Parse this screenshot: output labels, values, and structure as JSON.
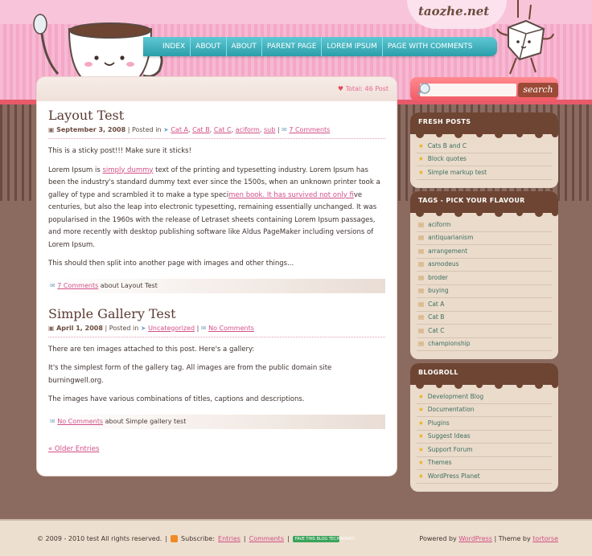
{
  "site": {
    "title": "taozhe.net"
  },
  "nav": {
    "items": [
      "INDEX",
      "ABOUT",
      "ABOUT",
      "PARENT PAGE",
      "LOREM IPSUM",
      "PAGE WITH COMMENTS"
    ]
  },
  "search": {
    "placeholder": "",
    "button_label": "search"
  },
  "main": {
    "total_posts": "Total: 46 Post"
  },
  "posts": [
    {
      "title": "Layout Test",
      "date": "September 3, 2008",
      "posted_in_label": "Posted in",
      "categories": [
        "Cat A",
        "Cat B",
        "Cat C",
        "aciform",
        "sub"
      ],
      "comments_label": "7 Comments",
      "body": {
        "p1": "This is a sticky post!!! Make sure it sticks!",
        "p2_a": "Lorem Ipsum is ",
        "p2_link1": "simply dummy",
        "p2_b": " text of the printing and typesetting industry. Lorem Ipsum has been the industry's standard dummy text ever since the 1500s, when an unknown printer took a galley of type and scrambled it to make a type speci",
        "p2_link2": "men book. It has survived not only fi",
        "p2_c": "ve centuries, but also the leap into electronic typesetting, remaining essentially unchanged. It was popularised in the 1960s with the release of Letraset sheets containing Lorem Ipsum passages, and more recently with desktop publishing software like Aldus PageMaker including versions of Lorem Ipsum.",
        "p3": "This should then split into another page with images and other things..."
      },
      "foot_comments": "7 Comments",
      "foot_about": "about Layout Test"
    },
    {
      "title": "Simple Gallery Test",
      "date": "April 1, 2008",
      "posted_in_label": "Posted in",
      "categories": [
        "Uncategorized"
      ],
      "comments_label": "No Comments",
      "body": {
        "p1": "There are ten images attached to this post.  Here's a gallery:",
        "p2": "It's the simplest form of the gallery tag.  All images are from the public domain site burningwell.org.",
        "p3": "The images have various combinations of titles, captions and descriptions."
      },
      "foot_comments": "No Comments",
      "foot_about": "about Simple gallery test"
    }
  ],
  "older_entries": "« Older Entries",
  "sidebar": {
    "fresh_posts": {
      "title": "FRESH POSTS",
      "items": [
        "Cats B and C",
        "Block quotes",
        "Simple markup test"
      ]
    },
    "tags": {
      "title": "TAGS - PICK YOUR FLAVOUR",
      "items": [
        "aciform",
        "antiquarianism",
        "arrangement",
        "asmodeus",
        "broder",
        "buying",
        "Cat A",
        "Cat B",
        "Cat C",
        "championship"
      ]
    },
    "blogroll": {
      "title": "BLOGROLL",
      "items": [
        "Development Blog",
        "Documentation",
        "Plugins",
        "Suggest Ideas",
        "Support Forum",
        "Themes",
        "WordPress Planet"
      ]
    }
  },
  "footer": {
    "copyright": "© 2009 - 2010 test All rights reserved.",
    "subscribe_label": "Subscribe:",
    "entries": "Entries",
    "comments": "Comments",
    "technorati_badge": "FAVE THIS BLOG TECHNORATI",
    "powered_by": "Powered by",
    "wordpress": "WordPress",
    "theme_by": "Theme by",
    "theme_author": "tortorse"
  },
  "colors": {
    "accent_pink": "#d34f86",
    "nav_teal": "#2a9eaa",
    "widget_brown": "#6e4532"
  }
}
